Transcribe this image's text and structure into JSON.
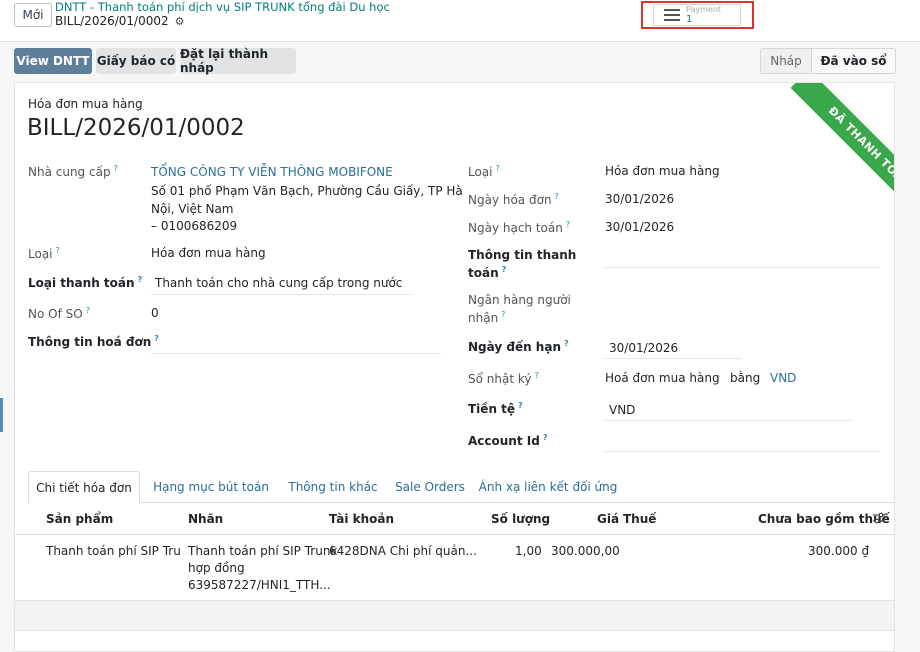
{
  "control_panel": {
    "new_button": "Mới",
    "breadcrumb_parent": "DNTT - Thanh toán phí dịch vụ SIP TRUNK tổng đài Du học",
    "breadcrumb_current": "BILL/2026/01/0002",
    "payment_widget": {
      "label": "Payment",
      "value": "1"
    }
  },
  "actions": {
    "view_dntt": "View DNTT",
    "credit_note": "Giấy báo có",
    "reset_draft": "Đặt lại thành nháp"
  },
  "statusbar": {
    "draft": "Nháp",
    "posted": "Đã vào sổ"
  },
  "ribbon": "ĐÃ THANH TOÁN",
  "document": {
    "type": "Hóa đơn mua hàng",
    "name": "BILL/2026/01/0002"
  },
  "left": {
    "vendor_label": "Nhà cung cấp",
    "vendor_name": "TỔNG CÔNG TY VIỄN THÔNG MOBIFONE",
    "vendor_addr1": "Số 01 phố Phạm Văn Bạch, Phường Cầu Giấy, TP Hà",
    "vendor_addr2": "Nội, Việt Nam",
    "vendor_addr3": "– 0100686209",
    "type_label": "Loại",
    "type_value": "Hóa đơn mua hàng",
    "payment_type_label": "Loại thanh toán",
    "payment_type_value": "Thanh toán cho nhà cung cấp trong nước",
    "no_of_so_label": "No Of SO",
    "no_of_so_value": "0",
    "invoice_info_label": "Thông tin hoá đơn"
  },
  "right": {
    "type_label": "Loại",
    "type_value": "Hóa đơn mua hàng",
    "invoice_date_label": "Ngày hóa đơn",
    "invoice_date_value": "30/01/2026",
    "accounting_date_label": "Ngày hạch toán",
    "accounting_date_value": "30/01/2026",
    "payment_info_label_1": "Thông tin thanh",
    "payment_info_label_2": "toán",
    "bank_label_1": "Ngân hàng người",
    "bank_label_2": "nhận",
    "due_date_label": "Ngày đến hạn",
    "due_date_value": "30/01/2026",
    "journal_label": "Sổ nhật ký",
    "journal_value": "Hoá đơn mua hàng",
    "journal_in": "bằng",
    "journal_currency": "VND",
    "currency_label": "Tiền tệ",
    "currency_value": "VND",
    "account_id_label": "Account Id"
  },
  "tabs": [
    "Chi tiết hóa đơn",
    "Hạng mục bút toán",
    "Thông tin khác",
    "Sale Orders",
    "Ánh xạ liên kết đối ứng"
  ],
  "table": {
    "headers": [
      "Sản phẩm",
      "Nhãn",
      "Tài khoản",
      "Số lượng",
      "Giá",
      "Thuế",
      "Chưa bao gồm thuế"
    ],
    "row": {
      "product": "Thanh toán phí SIP Trunk I",
      "label_1": "Thanh toán phí SIP Trunk",
      "label_2": "hợp đồng",
      "label_3": "639587227/HNI1_TTH...",
      "account": "6428DNA Chi phí quản...",
      "quantity": "1,00",
      "price": "300.000,00",
      "tax": "",
      "subtotal": "300.000 ₫"
    }
  }
}
